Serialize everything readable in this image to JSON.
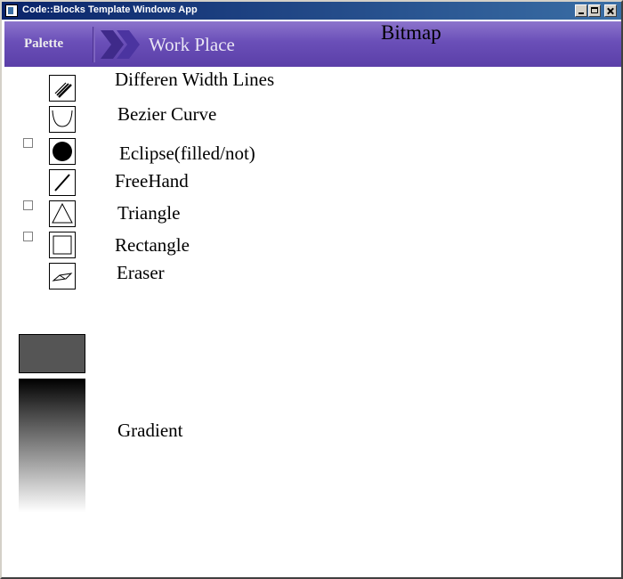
{
  "window": {
    "title": "Code::Blocks Template Windows App"
  },
  "toolbar": {
    "palette_label": "Palette",
    "workplace_label": "Work Place",
    "bitmap_label": "Bitmap"
  },
  "tools": [
    {
      "label": "Differen Width Lines",
      "icon": "multi-lines-icon"
    },
    {
      "label": "Bezier Curve",
      "icon": "bezier-icon"
    },
    {
      "label": "Eclipse(filled/not)",
      "icon": "filled-circle-icon",
      "checkbox": false
    },
    {
      "label": "FreeHand",
      "icon": "freehand-line-icon"
    },
    {
      "label": "Triangle",
      "icon": "triangle-icon",
      "checkbox": false
    },
    {
      "label": "Rectangle",
      "icon": "rectangle-icon",
      "checkbox": false
    },
    {
      "label": "Eraser",
      "icon": "eraser-icon"
    }
  ],
  "colors": {
    "current_color": "#555555",
    "header_purple": "#6a4fb8"
  },
  "gradient": {
    "label": "Gradient",
    "from": "#000000",
    "to": "#ffffff"
  }
}
